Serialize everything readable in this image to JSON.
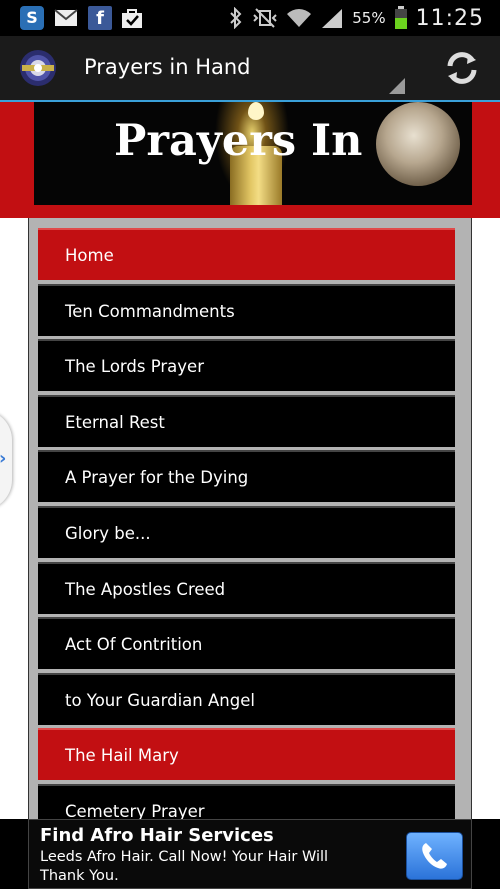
{
  "status_bar": {
    "icons": [
      "skype-icon",
      "gmail-icon",
      "facebook-icon",
      "shopping-bag-icon"
    ],
    "battery": "55%",
    "time": "11:25"
  },
  "action_bar": {
    "title": "Prayers in Hand"
  },
  "header": {
    "title": "Prayers In"
  },
  "nav": {
    "items": [
      {
        "label": "Home",
        "active": true
      },
      {
        "label": "Ten Commandments",
        "active": false
      },
      {
        "label": "The Lords Prayer",
        "active": false
      },
      {
        "label": "Eternal Rest",
        "active": false
      },
      {
        "label": "A Prayer for the Dying",
        "active": false
      },
      {
        "label": "Glory be...",
        "active": false
      },
      {
        "label": "The Apostles Creed",
        "active": false
      },
      {
        "label": "Act Of Contrition",
        "active": false
      },
      {
        "label": "to Your Guardian Angel",
        "active": false
      },
      {
        "label": "The Hail Mary",
        "active": true
      },
      {
        "label": "Cemetery Prayer",
        "active": false
      }
    ]
  },
  "ad": {
    "title": "Find Afro Hair Services",
    "text": "Leeds Afro Hair. Call Now! Your Hair Will Thank You."
  },
  "colors": {
    "accent_red": "#c20f12",
    "actionbar_line": "#3aa0d9"
  }
}
